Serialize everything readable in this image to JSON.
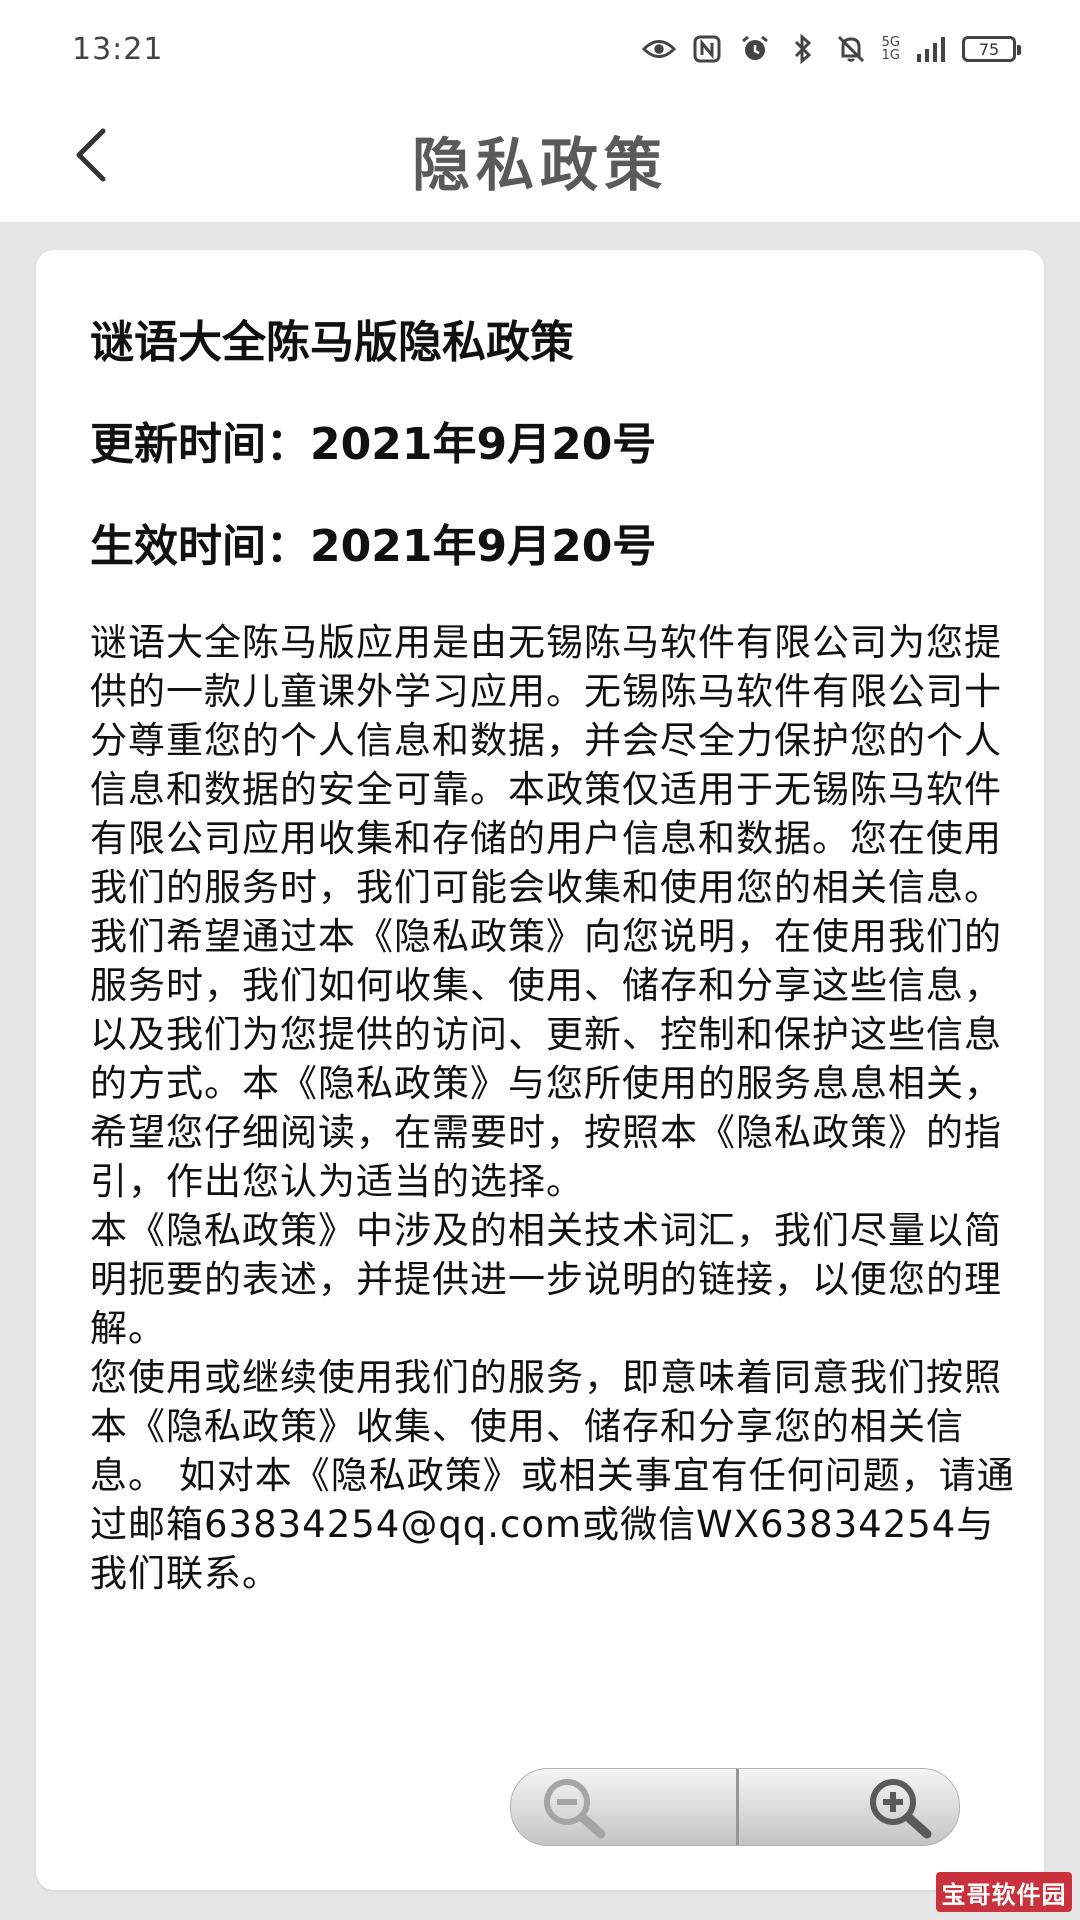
{
  "status_bar": {
    "time": "13:21",
    "signal_top": "5G",
    "signal_bottom": "1G",
    "battery": "75",
    "icons": [
      "eye-icon",
      "nfc-icon",
      "alarm-icon",
      "bluetooth-icon",
      "mute-icon",
      "signal-icon",
      "battery-icon"
    ]
  },
  "header": {
    "title": "隐私政策",
    "back_icon": "chevron-left-icon"
  },
  "document": {
    "title": "谜语大全陈马版隐私政策",
    "updated": "更新时间：2021年9月20号",
    "effective": "生效时间：2021年9月20号",
    "paragraphs": [
      "谜语大全陈马版应用是由无锡陈马软件有限公司为您提供的一款儿童课外学习应用。无锡陈马软件有限公司十分尊重您的个人信息和数据，并会尽全力保护您的个人信息和数据的安全可靠。本政策仅适用于无锡陈马软件有限公司应用收集和存储的用户信息和数据。您在使用我们的服务时，我们可能会收集和使用您的相关信息。",
      "我们希望通过本《隐私政策》向您说明，在使用我们的服务时，我们如何收集、使用、储存和分享这些信息，以及我们为您提供的访问、更新、控制和保护这些信息的方式。本《隐私政策》与您所使用的服务息息相关，希望您仔细阅读，在需要时，按照本《隐私政策》的指引，作出您认为适当的选择。",
      "本《隐私政策》中涉及的相关技术词汇，我们尽量以简明扼要的表述，并提供进一步说明的链接，以便您的理解。",
      "您使用或继续使用我们的服务，即意味着同意我们按照本《隐私政策》收集、使用、储存和分享您的相关信息。 如对本《隐私政策》或相关事宜有任何问题，请通过邮箱63834254@qq.com或微信WX63834254与我们联系。"
    ]
  },
  "zoom": {
    "out_icon": "zoom-out-icon",
    "in_icon": "zoom-in-icon"
  },
  "watermark": "宝哥软件园"
}
